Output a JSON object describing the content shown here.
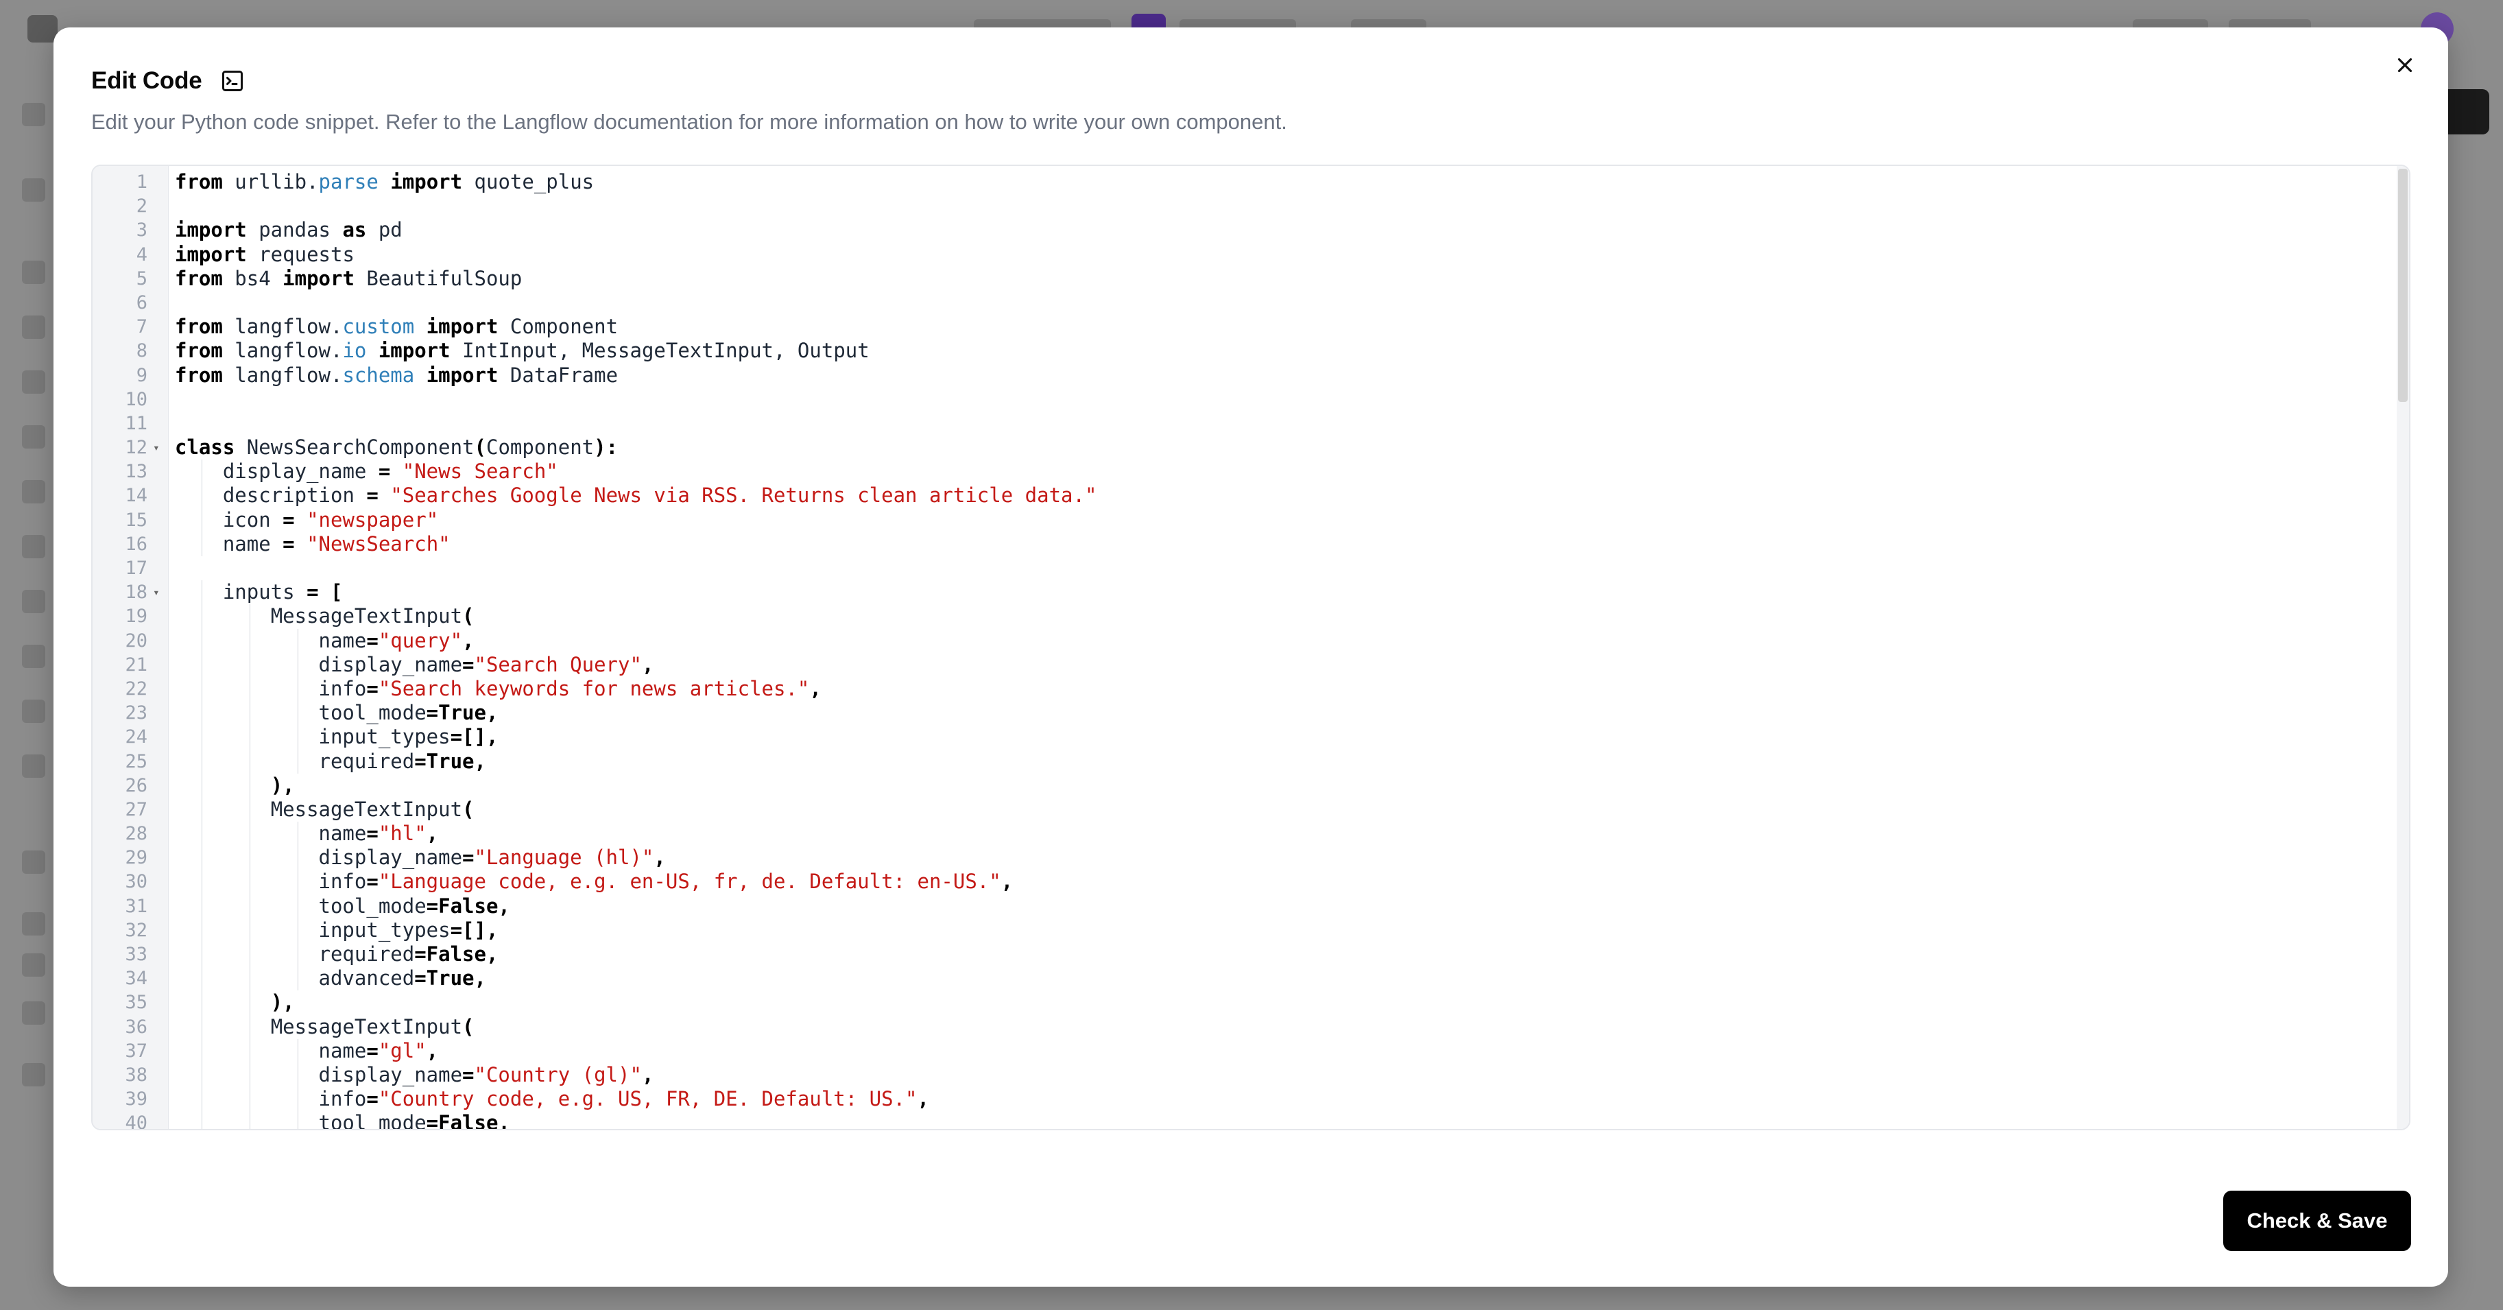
{
  "dialog": {
    "title": "Edit Code",
    "subtitle": "Edit your Python code snippet. Refer to the Langflow documentation for more information on how to write your own component.",
    "save_label": "Check & Save",
    "icons": {
      "title": "terminal-square-icon",
      "close": "close-icon"
    }
  },
  "editor": {
    "language": "python",
    "lines": [
      {
        "n": "1",
        "indent": 0,
        "tokens": [
          [
            "kw",
            "from"
          ],
          [
            "t",
            " urllib."
          ],
          [
            "mod",
            "parse"
          ],
          [
            "t",
            " "
          ],
          [
            "kw",
            "import"
          ],
          [
            "t",
            " quote_plus"
          ]
        ]
      },
      {
        "n": "2",
        "indent": 0,
        "tokens": []
      },
      {
        "n": "3",
        "indent": 0,
        "tokens": [
          [
            "kw",
            "import"
          ],
          [
            "t",
            " pandas "
          ],
          [
            "kw",
            "as"
          ],
          [
            "t",
            " pd"
          ]
        ]
      },
      {
        "n": "4",
        "indent": 0,
        "tokens": [
          [
            "kw",
            "import"
          ],
          [
            "t",
            " requests"
          ]
        ]
      },
      {
        "n": "5",
        "indent": 0,
        "tokens": [
          [
            "kw",
            "from"
          ],
          [
            "t",
            " bs4 "
          ],
          [
            "kw",
            "import"
          ],
          [
            "t",
            " BeautifulSoup"
          ]
        ]
      },
      {
        "n": "6",
        "indent": 0,
        "tokens": []
      },
      {
        "n": "7",
        "indent": 0,
        "tokens": [
          [
            "kw",
            "from"
          ],
          [
            "t",
            " langflow."
          ],
          [
            "mod",
            "custom"
          ],
          [
            "t",
            " "
          ],
          [
            "kw",
            "import"
          ],
          [
            "t",
            " Component"
          ]
        ]
      },
      {
        "n": "8",
        "indent": 0,
        "tokens": [
          [
            "kw",
            "from"
          ],
          [
            "t",
            " langflow."
          ],
          [
            "mod",
            "io"
          ],
          [
            "t",
            " "
          ],
          [
            "kw",
            "import"
          ],
          [
            "t",
            " IntInput, MessageTextInput, Output"
          ]
        ]
      },
      {
        "n": "9",
        "indent": 0,
        "tokens": [
          [
            "kw",
            "from"
          ],
          [
            "t",
            " langflow."
          ],
          [
            "mod",
            "schema"
          ],
          [
            "t",
            " "
          ],
          [
            "kw",
            "import"
          ],
          [
            "t",
            " DataFrame"
          ]
        ]
      },
      {
        "n": "10",
        "indent": 0,
        "tokens": []
      },
      {
        "n": "11",
        "indent": 0,
        "tokens": []
      },
      {
        "n": "12",
        "indent": 0,
        "fold": true,
        "tokens": [
          [
            "kw",
            "class"
          ],
          [
            "t",
            " NewsSearchComponent"
          ],
          [
            "kw",
            "("
          ],
          [
            "t",
            "Component"
          ],
          [
            "kw",
            "):"
          ]
        ]
      },
      {
        "n": "13",
        "indent": 1,
        "tokens": [
          [
            "t",
            "display_name "
          ],
          [
            "kw",
            "="
          ],
          [
            "t",
            " "
          ],
          [
            "str",
            "\"News Search\""
          ]
        ]
      },
      {
        "n": "14",
        "indent": 1,
        "tokens": [
          [
            "t",
            "description "
          ],
          [
            "kw",
            "="
          ],
          [
            "t",
            " "
          ],
          [
            "str",
            "\"Searches Google News via RSS. Returns clean article data.\""
          ]
        ]
      },
      {
        "n": "15",
        "indent": 1,
        "tokens": [
          [
            "t",
            "icon "
          ],
          [
            "kw",
            "="
          ],
          [
            "t",
            " "
          ],
          [
            "str",
            "\"newspaper\""
          ]
        ]
      },
      {
        "n": "16",
        "indent": 1,
        "tokens": [
          [
            "t",
            "name "
          ],
          [
            "kw",
            "="
          ],
          [
            "t",
            " "
          ],
          [
            "str",
            "\"NewsSearch\""
          ]
        ]
      },
      {
        "n": "17",
        "indent": 0,
        "tokens": []
      },
      {
        "n": "18",
        "indent": 1,
        "fold": true,
        "tokens": [
          [
            "t",
            "inputs "
          ],
          [
            "kw",
            "="
          ],
          [
            "t",
            " "
          ],
          [
            "kw",
            "["
          ]
        ]
      },
      {
        "n": "19",
        "indent": 2,
        "tokens": [
          [
            "t",
            "MessageTextInput"
          ],
          [
            "kw",
            "("
          ]
        ]
      },
      {
        "n": "20",
        "indent": 3,
        "tokens": [
          [
            "t",
            "name"
          ],
          [
            "kw",
            "="
          ],
          [
            "str",
            "\"query\""
          ],
          [
            "kw",
            ","
          ]
        ]
      },
      {
        "n": "21",
        "indent": 3,
        "tokens": [
          [
            "t",
            "display_name"
          ],
          [
            "kw",
            "="
          ],
          [
            "str",
            "\"Search Query\""
          ],
          [
            "kw",
            ","
          ]
        ]
      },
      {
        "n": "22",
        "indent": 3,
        "tokens": [
          [
            "t",
            "info"
          ],
          [
            "kw",
            "="
          ],
          [
            "str",
            "\"Search keywords for news articles.\""
          ],
          [
            "kw",
            ","
          ]
        ]
      },
      {
        "n": "23",
        "indent": 3,
        "tokens": [
          [
            "t",
            "tool_mode"
          ],
          [
            "kw",
            "=True,"
          ]
        ]
      },
      {
        "n": "24",
        "indent": 3,
        "tokens": [
          [
            "t",
            "input_types"
          ],
          [
            "kw",
            "=[],"
          ]
        ]
      },
      {
        "n": "25",
        "indent": 3,
        "tokens": [
          [
            "t",
            "required"
          ],
          [
            "kw",
            "=True,"
          ]
        ]
      },
      {
        "n": "26",
        "indent": 2,
        "tokens": [
          [
            "kw",
            "),"
          ]
        ]
      },
      {
        "n": "27",
        "indent": 2,
        "tokens": [
          [
            "t",
            "MessageTextInput"
          ],
          [
            "kw",
            "("
          ]
        ]
      },
      {
        "n": "28",
        "indent": 3,
        "tokens": [
          [
            "t",
            "name"
          ],
          [
            "kw",
            "="
          ],
          [
            "str",
            "\"hl\""
          ],
          [
            "kw",
            ","
          ]
        ]
      },
      {
        "n": "29",
        "indent": 3,
        "tokens": [
          [
            "t",
            "display_name"
          ],
          [
            "kw",
            "="
          ],
          [
            "str",
            "\"Language (hl)\""
          ],
          [
            "kw",
            ","
          ]
        ]
      },
      {
        "n": "30",
        "indent": 3,
        "tokens": [
          [
            "t",
            "info"
          ],
          [
            "kw",
            "="
          ],
          [
            "str",
            "\"Language code, e.g. en-US, fr, de. Default: en-US.\""
          ],
          [
            "kw",
            ","
          ]
        ]
      },
      {
        "n": "31",
        "indent": 3,
        "tokens": [
          [
            "t",
            "tool_mode"
          ],
          [
            "kw",
            "=False,"
          ]
        ]
      },
      {
        "n": "32",
        "indent": 3,
        "tokens": [
          [
            "t",
            "input_types"
          ],
          [
            "kw",
            "=[],"
          ]
        ]
      },
      {
        "n": "33",
        "indent": 3,
        "tokens": [
          [
            "t",
            "required"
          ],
          [
            "kw",
            "=False,"
          ]
        ]
      },
      {
        "n": "34",
        "indent": 3,
        "tokens": [
          [
            "t",
            "advanced"
          ],
          [
            "kw",
            "=True,"
          ]
        ]
      },
      {
        "n": "35",
        "indent": 2,
        "tokens": [
          [
            "kw",
            "),"
          ]
        ]
      },
      {
        "n": "36",
        "indent": 2,
        "tokens": [
          [
            "t",
            "MessageTextInput"
          ],
          [
            "kw",
            "("
          ]
        ]
      },
      {
        "n": "37",
        "indent": 3,
        "tokens": [
          [
            "t",
            "name"
          ],
          [
            "kw",
            "="
          ],
          [
            "str",
            "\"gl\""
          ],
          [
            "kw",
            ","
          ]
        ]
      },
      {
        "n": "38",
        "indent": 3,
        "tokens": [
          [
            "t",
            "display_name"
          ],
          [
            "kw",
            "="
          ],
          [
            "str",
            "\"Country (gl)\""
          ],
          [
            "kw",
            ","
          ]
        ]
      },
      {
        "n": "39",
        "indent": 3,
        "tokens": [
          [
            "t",
            "info"
          ],
          [
            "kw",
            "="
          ],
          [
            "str",
            "\"Country code, e.g. US, FR, DE. Default: US.\""
          ],
          [
            "kw",
            ","
          ]
        ]
      },
      {
        "n": "40",
        "indent": 3,
        "tokens": [
          [
            "t",
            "tool_mode"
          ],
          [
            "kw",
            "=False,"
          ]
        ]
      }
    ]
  }
}
